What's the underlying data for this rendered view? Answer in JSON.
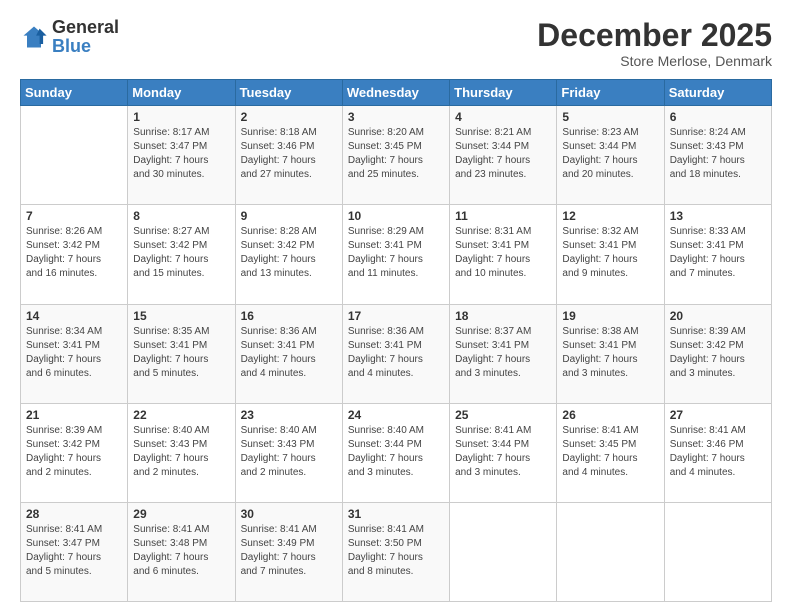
{
  "header": {
    "logo_general": "General",
    "logo_blue": "Blue",
    "title": "December 2025",
    "subtitle": "Store Merlose, Denmark"
  },
  "calendar": {
    "days_of_week": [
      "Sunday",
      "Monday",
      "Tuesday",
      "Wednesday",
      "Thursday",
      "Friday",
      "Saturday"
    ],
    "weeks": [
      [
        {
          "day": "",
          "text": ""
        },
        {
          "day": "1",
          "text": "Sunrise: 8:17 AM\nSunset: 3:47 PM\nDaylight: 7 hours\nand 30 minutes."
        },
        {
          "day": "2",
          "text": "Sunrise: 8:18 AM\nSunset: 3:46 PM\nDaylight: 7 hours\nand 27 minutes."
        },
        {
          "day": "3",
          "text": "Sunrise: 8:20 AM\nSunset: 3:45 PM\nDaylight: 7 hours\nand 25 minutes."
        },
        {
          "day": "4",
          "text": "Sunrise: 8:21 AM\nSunset: 3:44 PM\nDaylight: 7 hours\nand 23 minutes."
        },
        {
          "day": "5",
          "text": "Sunrise: 8:23 AM\nSunset: 3:44 PM\nDaylight: 7 hours\nand 20 minutes."
        },
        {
          "day": "6",
          "text": "Sunrise: 8:24 AM\nSunset: 3:43 PM\nDaylight: 7 hours\nand 18 minutes."
        }
      ],
      [
        {
          "day": "7",
          "text": "Sunrise: 8:26 AM\nSunset: 3:42 PM\nDaylight: 7 hours\nand 16 minutes."
        },
        {
          "day": "8",
          "text": "Sunrise: 8:27 AM\nSunset: 3:42 PM\nDaylight: 7 hours\nand 15 minutes."
        },
        {
          "day": "9",
          "text": "Sunrise: 8:28 AM\nSunset: 3:42 PM\nDaylight: 7 hours\nand 13 minutes."
        },
        {
          "day": "10",
          "text": "Sunrise: 8:29 AM\nSunset: 3:41 PM\nDaylight: 7 hours\nand 11 minutes."
        },
        {
          "day": "11",
          "text": "Sunrise: 8:31 AM\nSunset: 3:41 PM\nDaylight: 7 hours\nand 10 minutes."
        },
        {
          "day": "12",
          "text": "Sunrise: 8:32 AM\nSunset: 3:41 PM\nDaylight: 7 hours\nand 9 minutes."
        },
        {
          "day": "13",
          "text": "Sunrise: 8:33 AM\nSunset: 3:41 PM\nDaylight: 7 hours\nand 7 minutes."
        }
      ],
      [
        {
          "day": "14",
          "text": "Sunrise: 8:34 AM\nSunset: 3:41 PM\nDaylight: 7 hours\nand 6 minutes."
        },
        {
          "day": "15",
          "text": "Sunrise: 8:35 AM\nSunset: 3:41 PM\nDaylight: 7 hours\nand 5 minutes."
        },
        {
          "day": "16",
          "text": "Sunrise: 8:36 AM\nSunset: 3:41 PM\nDaylight: 7 hours\nand 4 minutes."
        },
        {
          "day": "17",
          "text": "Sunrise: 8:36 AM\nSunset: 3:41 PM\nDaylight: 7 hours\nand 4 minutes."
        },
        {
          "day": "18",
          "text": "Sunrise: 8:37 AM\nSunset: 3:41 PM\nDaylight: 7 hours\nand 3 minutes."
        },
        {
          "day": "19",
          "text": "Sunrise: 8:38 AM\nSunset: 3:41 PM\nDaylight: 7 hours\nand 3 minutes."
        },
        {
          "day": "20",
          "text": "Sunrise: 8:39 AM\nSunset: 3:42 PM\nDaylight: 7 hours\nand 3 minutes."
        }
      ],
      [
        {
          "day": "21",
          "text": "Sunrise: 8:39 AM\nSunset: 3:42 PM\nDaylight: 7 hours\nand 2 minutes."
        },
        {
          "day": "22",
          "text": "Sunrise: 8:40 AM\nSunset: 3:43 PM\nDaylight: 7 hours\nand 2 minutes."
        },
        {
          "day": "23",
          "text": "Sunrise: 8:40 AM\nSunset: 3:43 PM\nDaylight: 7 hours\nand 2 minutes."
        },
        {
          "day": "24",
          "text": "Sunrise: 8:40 AM\nSunset: 3:44 PM\nDaylight: 7 hours\nand 3 minutes."
        },
        {
          "day": "25",
          "text": "Sunrise: 8:41 AM\nSunset: 3:44 PM\nDaylight: 7 hours\nand 3 minutes."
        },
        {
          "day": "26",
          "text": "Sunrise: 8:41 AM\nSunset: 3:45 PM\nDaylight: 7 hours\nand 4 minutes."
        },
        {
          "day": "27",
          "text": "Sunrise: 8:41 AM\nSunset: 3:46 PM\nDaylight: 7 hours\nand 4 minutes."
        }
      ],
      [
        {
          "day": "28",
          "text": "Sunrise: 8:41 AM\nSunset: 3:47 PM\nDaylight: 7 hours\nand 5 minutes."
        },
        {
          "day": "29",
          "text": "Sunrise: 8:41 AM\nSunset: 3:48 PM\nDaylight: 7 hours\nand 6 minutes."
        },
        {
          "day": "30",
          "text": "Sunrise: 8:41 AM\nSunset: 3:49 PM\nDaylight: 7 hours\nand 7 minutes."
        },
        {
          "day": "31",
          "text": "Sunrise: 8:41 AM\nSunset: 3:50 PM\nDaylight: 7 hours\nand 8 minutes."
        },
        {
          "day": "",
          "text": ""
        },
        {
          "day": "",
          "text": ""
        },
        {
          "day": "",
          "text": ""
        }
      ]
    ]
  }
}
